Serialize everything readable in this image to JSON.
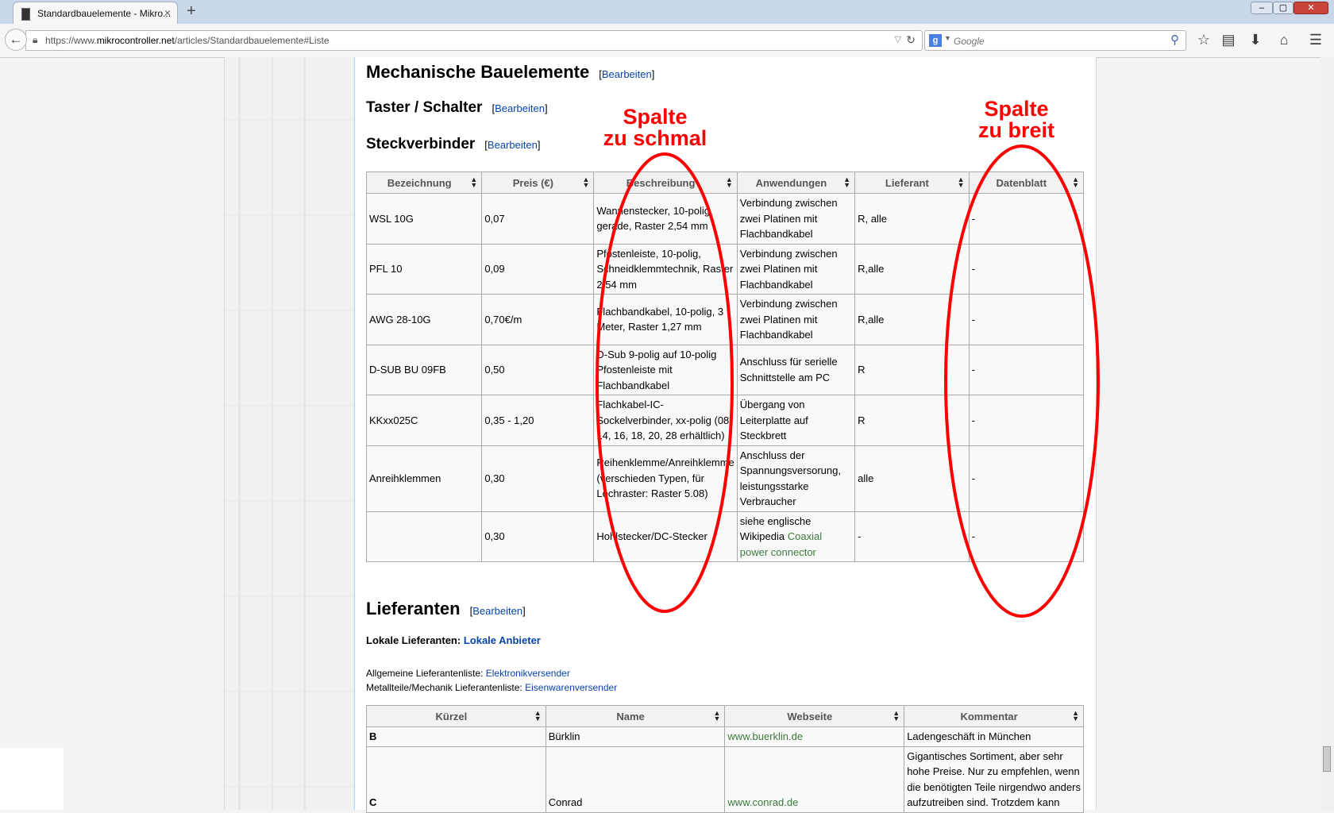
{
  "browser": {
    "tab_title": "Standardbauelemente - Mikro...",
    "tab_close": "×",
    "new_tab": "+",
    "url_prefix": "https://www.",
    "url_domain": "mikrocontroller.net",
    "url_path": "/articles/Standardbauelemente#Liste",
    "search_placeholder": "Google",
    "window_buttons": [
      "–",
      "▢",
      "✕"
    ]
  },
  "article": {
    "section_mech": "Mechanische Bauelemente",
    "section_taster": "Taster / Schalter",
    "section_steck": "Steckverbinder",
    "section_lieferanten": "Lieferanten",
    "edit_label": "Bearbeiten",
    "lokale_label": "Lokale Lieferanten:",
    "lokale_link": "Lokale Anbieter",
    "allgemein_label": "Allgemeine Lieferantenliste:",
    "allgemein_link": "Elektronikversender",
    "metall_label": "Metallteile/Mechanik Lieferantenliste:",
    "metall_link": "Eisenwarenversender"
  },
  "steck_table": {
    "headers": [
      "Bezeichnung",
      "Preis (€)",
      "Beschreibung",
      "Anwendungen",
      "Lieferant",
      "Datenblatt"
    ],
    "rows": [
      [
        "WSL 10G",
        "0,07",
        "Wannenstecker, 10-polig, gerade, Raster 2,54 mm",
        "Verbindung zwischen zwei Platinen mit Flachbandkabel",
        "R, alle",
        "-"
      ],
      [
        "PFL 10",
        "0,09",
        "Pfostenleiste, 10-polig, Schneidklemmtechnik, Raster 2,54 mm",
        "Verbindung zwischen zwei Platinen mit Flachbandkabel",
        "R,alle",
        "-"
      ],
      [
        "AWG 28-10G",
        "0,70€/m",
        "Flachbandkabel, 10-polig, 3 Meter, Raster 1,27 mm",
        "Verbindung zwischen zwei Platinen mit Flachbandkabel",
        "R,alle",
        "-"
      ],
      [
        "D-SUB BU 09FB",
        "0,50",
        "D-Sub 9-polig auf 10-polig Pfostenleiste mit Flachbandkabel",
        "Anschluss für serielle Schnittstelle am PC",
        "R",
        "-"
      ],
      [
        "KKxx025C",
        "0,35 - 1,20",
        "Flachkabel-IC-Sockelverbinder, xx-polig (08, 14, 16, 18, 20, 28 erhältlich)",
        "Übergang von Leiterplatte auf Steckbrett",
        "R",
        "-"
      ],
      [
        "Anreihklemmen",
        "0,30",
        "Reihenklemme/Anreihklemme (verschieden Typen, für Lochraster: Raster 5.08)",
        "Anschluss der Spannungsversorung, leistungsstarke Verbraucher",
        "alle",
        "-"
      ],
      [
        "",
        "0,30",
        "Hohlstecker/DC-Stecker",
        "siehe englische Wikipedia ",
        "-",
        "-"
      ]
    ],
    "last_row_link": "Coaxial power connector"
  },
  "liefer_table": {
    "headers": [
      "Kürzel",
      "Name",
      "Webseite",
      "Kommentar"
    ],
    "rows": [
      [
        "B",
        "Bürklin",
        "www.buerklin.de",
        "Ladengeschäft in München"
      ],
      [
        "C",
        "Conrad",
        "www.conrad.de",
        "Gigantisches Sortiment, aber sehr hohe Preise. Nur zu empfehlen, wenn die benötigten Teile nirgendwo anders aufzutreiben sind. Trotzdem kann"
      ]
    ]
  },
  "annotations": {
    "narrow_line1": "Spalte",
    "narrow_line2": "zu schmal",
    "wide_line1": "Spalte",
    "wide_line2": "zu breit",
    "color": "#ff0000"
  },
  "colors": {
    "link": "#0645ad",
    "external_link": "#3a7a3a",
    "annotation": "#ff0000"
  }
}
